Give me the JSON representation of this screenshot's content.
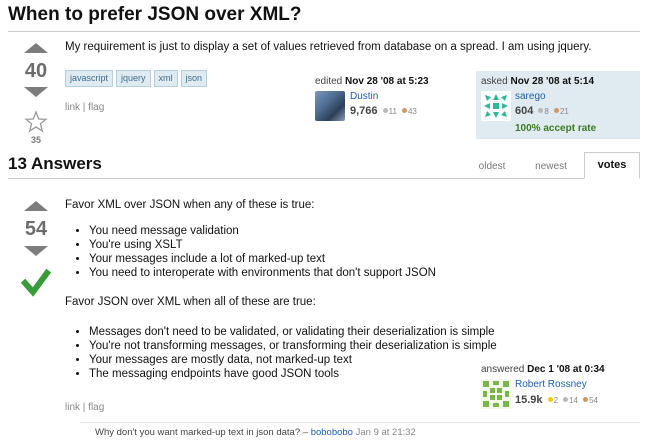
{
  "question": {
    "title": "When to prefer JSON over XML?",
    "body": "My requirement is just to display a set of values retrieved from database on a spread. I am using jquery.",
    "votes": "40",
    "favorites": "35",
    "tags": [
      "javascript",
      "jquery",
      "xml",
      "json"
    ],
    "links": {
      "link": "link",
      "flag": "flag"
    },
    "edited": {
      "label": "edited",
      "date": "Nov 28 '08 at 5:23",
      "user": "Dustin",
      "rep": "9,766",
      "silver": "11",
      "bronze": "43"
    },
    "asked": {
      "label": "asked",
      "date": "Nov 28 '08 at 5:14",
      "user": "sarego",
      "rep": "604",
      "silver": "8",
      "bronze": "21",
      "accept_rate": "100% accept rate"
    }
  },
  "answers_header": {
    "title": "13 Answers",
    "tabs": [
      "oldest",
      "newest",
      "votes"
    ],
    "active_tab": "votes"
  },
  "answer": {
    "votes": "54",
    "intro1": "Favor XML over JSON when any of these is true:",
    "list1": [
      "You need message validation",
      "You're using XSLT",
      "Your messages include a lot of marked-up text",
      "You need to interoperate with environments that don't support JSON"
    ],
    "intro2": "Favor JSON over XML when all of these are true:",
    "list2": [
      "Messages don't need to be validated, or validating their deserialization is simple",
      "You're not transforming messages, or transforming their deserialization is simple",
      "Your messages are mostly data, not marked-up text",
      "The messaging endpoints have good JSON tools"
    ],
    "links": {
      "link": "link",
      "flag": "flag"
    },
    "answered": {
      "label": "answered",
      "date": "Dec 1 '08 at 0:34",
      "user": "Robert Rossney",
      "rep": "15.9k",
      "gold": "2",
      "silver": "14",
      "bronze": "54"
    },
    "comment": {
      "text": "Why don't you want marked-up text in json data? –",
      "author": "bobobobo",
      "date": "Jan 9 at 21:32"
    }
  },
  "colors": {
    "link": "#1c5fb0",
    "tag_bg": "#e0eaf1",
    "accepted": "#3a9b3a",
    "owner_card": "#e0eaf1"
  }
}
